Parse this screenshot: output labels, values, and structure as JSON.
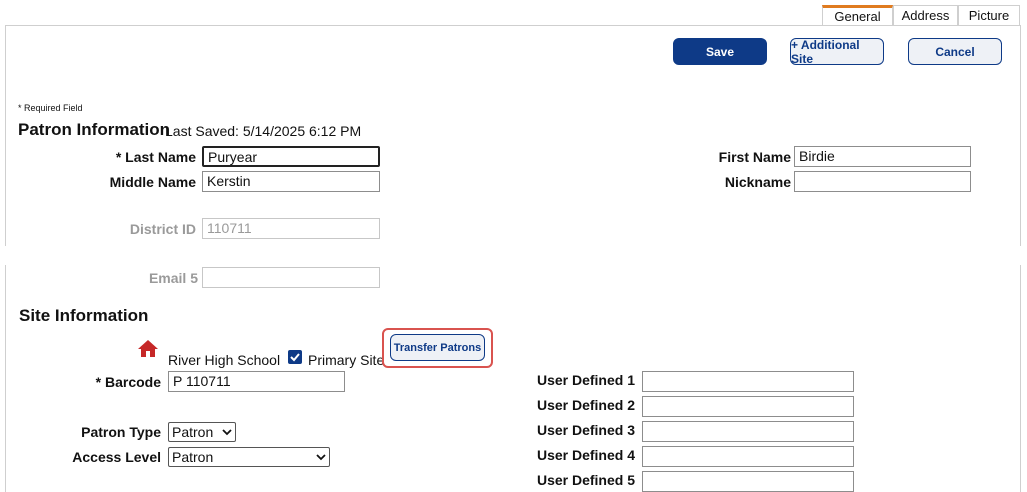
{
  "tabs": [
    {
      "label": "General",
      "active": true
    },
    {
      "label": "Address",
      "active": false
    },
    {
      "label": "Picture",
      "active": false
    }
  ],
  "toolbar": {
    "save_label": "Save",
    "additional_site_label": "+ Additional Site",
    "cancel_label": "Cancel"
  },
  "required_note": "* Required Field",
  "patron_info": {
    "heading": "Patron Information",
    "last_saved": "Last Saved: 5/14/2025 6:12 PM",
    "last_name_label": "* Last Name",
    "last_name_value": "Puryear",
    "first_name_label": "First Name",
    "first_name_value": "Birdie",
    "middle_name_label": "Middle Name",
    "middle_name_value": "Kerstin",
    "nickname_label": "Nickname",
    "nickname_value": "",
    "district_id_label": "District ID",
    "district_id_value": "110711",
    "email5_label": "Email 5",
    "email5_value": ""
  },
  "site_info": {
    "heading": "Site Information",
    "site_name": "River High School",
    "primary_site_label": "Primary Site",
    "primary_site_checked": true,
    "transfer_label": "Transfer Patrons",
    "barcode_label": "* Barcode",
    "barcode_value": "P 110711",
    "patron_type_label": "Patron Type",
    "patron_type_value": "Patron",
    "access_level_label": "Access Level",
    "access_level_value": "Patron",
    "user_defined": [
      {
        "label": "User Defined 1",
        "value": ""
      },
      {
        "label": "User Defined 2",
        "value": ""
      },
      {
        "label": "User Defined 3",
        "value": ""
      },
      {
        "label": "User Defined 4",
        "value": ""
      },
      {
        "label": "User Defined 5",
        "value": ""
      }
    ]
  },
  "colors": {
    "primary": "#0e3a87",
    "highlight": "#d9534f",
    "tab_accent": "#e07b1f",
    "home_icon": "#c62828"
  }
}
